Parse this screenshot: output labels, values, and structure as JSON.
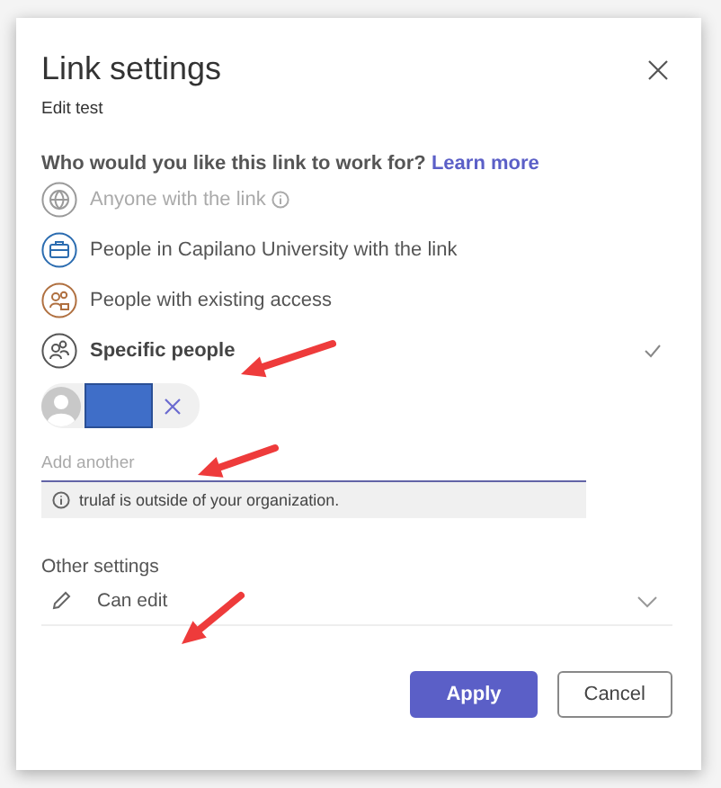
{
  "dialog": {
    "title": "Link settings",
    "subtitle": "Edit test",
    "question": "Who would you like this link to work for?",
    "learn_more": "Learn more",
    "options": [
      {
        "kind": "globe",
        "label": "Anyone with the link",
        "info": true,
        "disabled": true,
        "selected": false
      },
      {
        "kind": "briefcase",
        "label": "People in Capilano University with the link",
        "info": false,
        "disabled": false,
        "selected": false
      },
      {
        "kind": "existing",
        "label": "People with existing access",
        "info": false,
        "disabled": false,
        "selected": false
      },
      {
        "kind": "people",
        "label": "Specific people",
        "info": false,
        "disabled": false,
        "selected": true
      }
    ],
    "recipients": [
      {
        "redacted": true
      }
    ],
    "add_field": {
      "placeholder": "Add another"
    },
    "notice": "trulaf is outside of your organization.",
    "other_settings": {
      "heading": "Other settings",
      "permission": "Can edit"
    },
    "buttons": [
      {
        "kind": "primary",
        "label": "Apply"
      },
      {
        "kind": "secondary",
        "label": "Cancel"
      }
    ]
  },
  "annotations": [
    {
      "kind": "arrow"
    },
    {
      "kind": "arrow"
    },
    {
      "kind": "arrow"
    }
  ]
}
